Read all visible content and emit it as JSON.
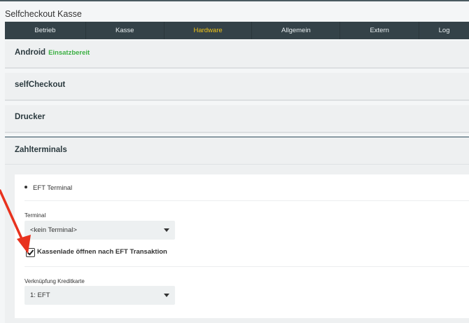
{
  "app": {
    "title": "Selfcheckout Kasse"
  },
  "nav": {
    "items": [
      "Betrieb",
      "Kasse",
      "Hardware",
      "Allgemein",
      "Extern",
      "Log"
    ],
    "active_index": 2
  },
  "sections": {
    "android": {
      "title": "Android",
      "status": "Einsatzbereit"
    },
    "selfcheckout": {
      "title": "selfCheckout"
    },
    "drucker": {
      "title": "Drucker"
    },
    "zahlterminals": {
      "title": "Zahlterminals",
      "terminal_item": "EFT Terminal",
      "terminal_label": "Terminal",
      "terminal_value": "<kein Terminal>",
      "checkbox_label": "Kassenlade öffnen nach EFT Transaktion",
      "checkbox_checked": true,
      "card_link_label": "Verknüpfung Kreditkarte",
      "card_link_value": "1: EFT"
    }
  },
  "colors": {
    "nav_bg": "#344248",
    "nav_active": "#f0c419",
    "status_ok": "#3cb043",
    "annotation_arrow": "#e8321e"
  },
  "icons": [
    "check-icon",
    "caret-down-icon",
    "arrow-annotation-icon"
  ]
}
